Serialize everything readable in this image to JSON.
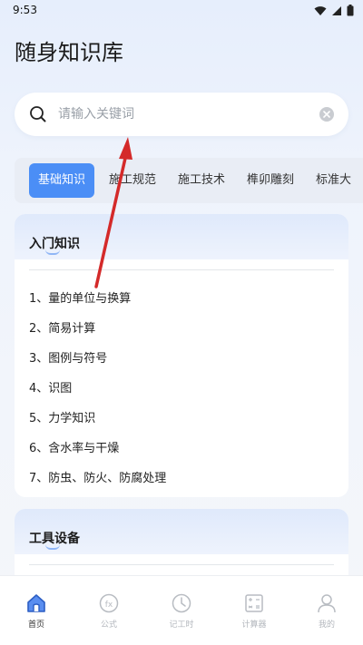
{
  "status_bar": {
    "time": "9:53"
  },
  "app": {
    "title": "随身知识库"
  },
  "search": {
    "placeholder": "请输入关键词",
    "value": ""
  },
  "tabs": [
    {
      "label": "基础知识",
      "active": true
    },
    {
      "label": "施工规范",
      "active": false
    },
    {
      "label": "施工技术",
      "active": false
    },
    {
      "label": "榫卯雕刻",
      "active": false
    },
    {
      "label": "标准大",
      "active": false
    }
  ],
  "sections": [
    {
      "title": "入门知识",
      "items": [
        "1、量的单位与换算",
        "2、简易计算",
        "3、图例与符号",
        "4、识图",
        "5、力学知识",
        "6、含水率与干燥",
        "7、防虫、防火、防腐处理"
      ]
    },
    {
      "title": "工具设备",
      "items": []
    }
  ],
  "bottom_nav": [
    {
      "label": "首页",
      "icon": "home-icon",
      "active": true
    },
    {
      "label": "公式",
      "icon": "formula-icon",
      "active": false
    },
    {
      "label": "记工时",
      "icon": "clock-icon",
      "active": false
    },
    {
      "label": "计算器",
      "icon": "calculator-icon",
      "active": false
    },
    {
      "label": "我的",
      "icon": "profile-icon",
      "active": false
    }
  ],
  "colors": {
    "accent": "#4b8ef6",
    "annotation": "#d42a2a",
    "nav_active": "#3c6fd6",
    "nav_inactive": "#b8bcc2"
  }
}
